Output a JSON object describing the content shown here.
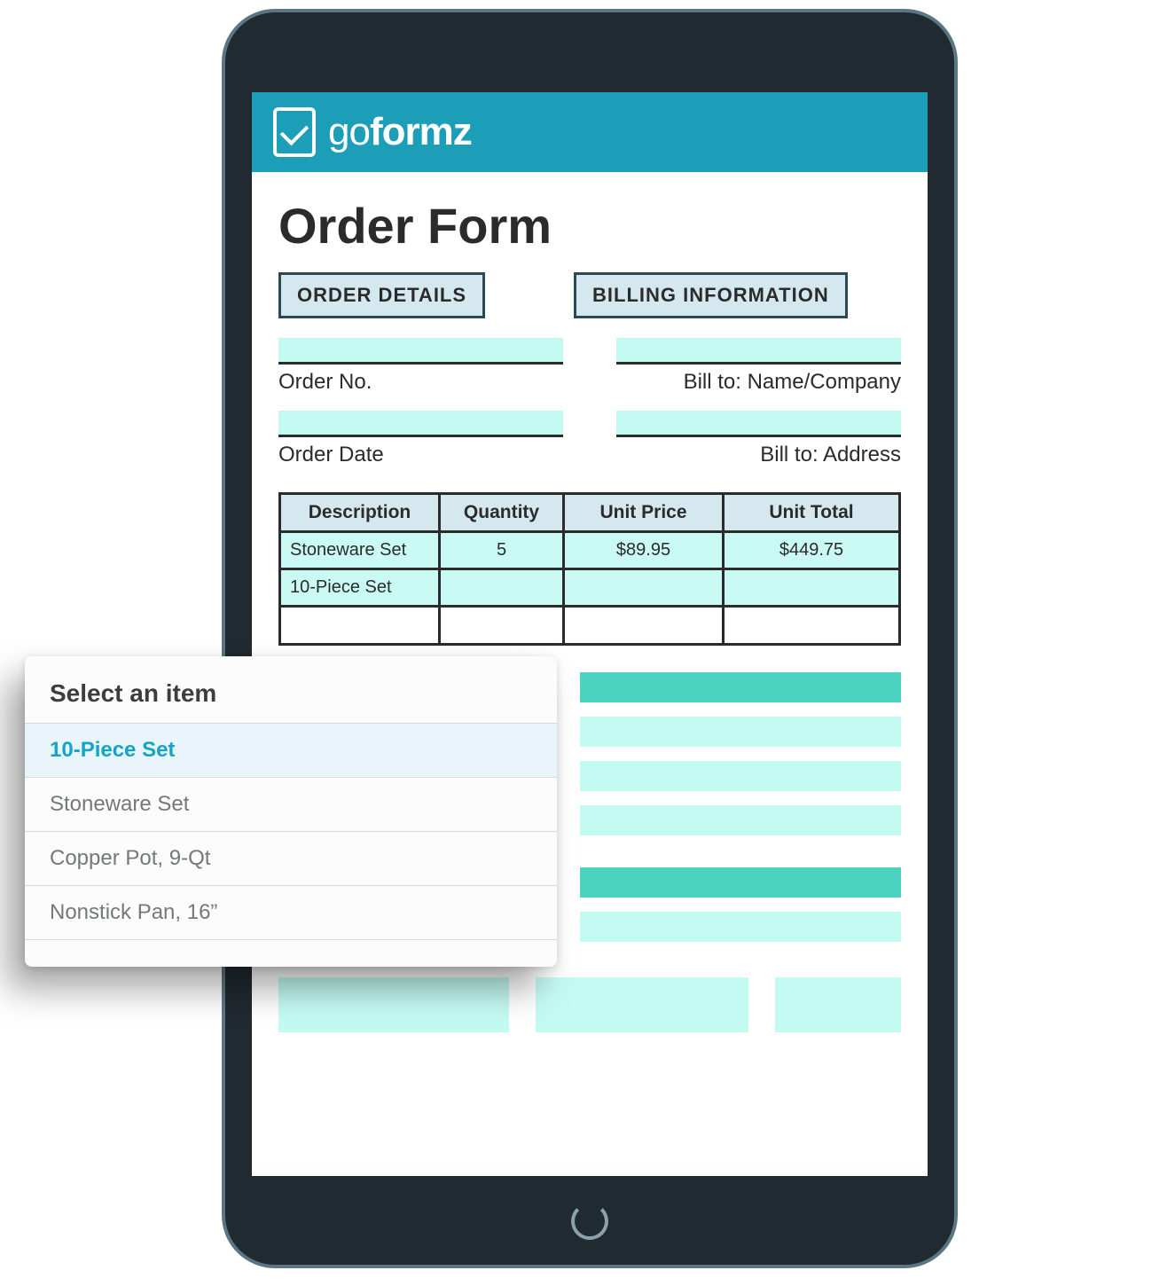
{
  "brand": {
    "name_light": "go",
    "name_bold": "formz"
  },
  "form": {
    "title": "Order Form",
    "sections": {
      "order_details": "ORDER DETAILS",
      "billing_info": "BILLING INFORMATION"
    },
    "labels": {
      "order_no": "Order No.",
      "order_date": "Order Date",
      "bill_to_name": "Bill to: Name/Company",
      "bill_to_address": "Bill to: Address"
    }
  },
  "table": {
    "headers": {
      "desc": "Description",
      "qty": "Quantity",
      "price": "Unit Price",
      "total": "Unit Total"
    },
    "rows": [
      {
        "desc": "Stoneware Set",
        "qty": "5",
        "price": "$89.95",
        "total": "$449.75"
      },
      {
        "desc": "10-Piece Set",
        "qty": "",
        "price": "",
        "total": ""
      }
    ]
  },
  "popup": {
    "title": "Select an item",
    "items": [
      {
        "label": "10-Piece Set",
        "selected": true
      },
      {
        "label": "Stoneware Set",
        "selected": false
      },
      {
        "label": "Copper Pot, 9-Qt",
        "selected": false
      },
      {
        "label": "Nonstick Pan, 16”",
        "selected": false
      }
    ]
  },
  "colors": {
    "header": "#1c9eb9",
    "section_bg": "#d6e8ef",
    "field_bg": "#c3fbf2",
    "bar_dark": "#4dd3c2",
    "accent": "#13a5c6"
  }
}
